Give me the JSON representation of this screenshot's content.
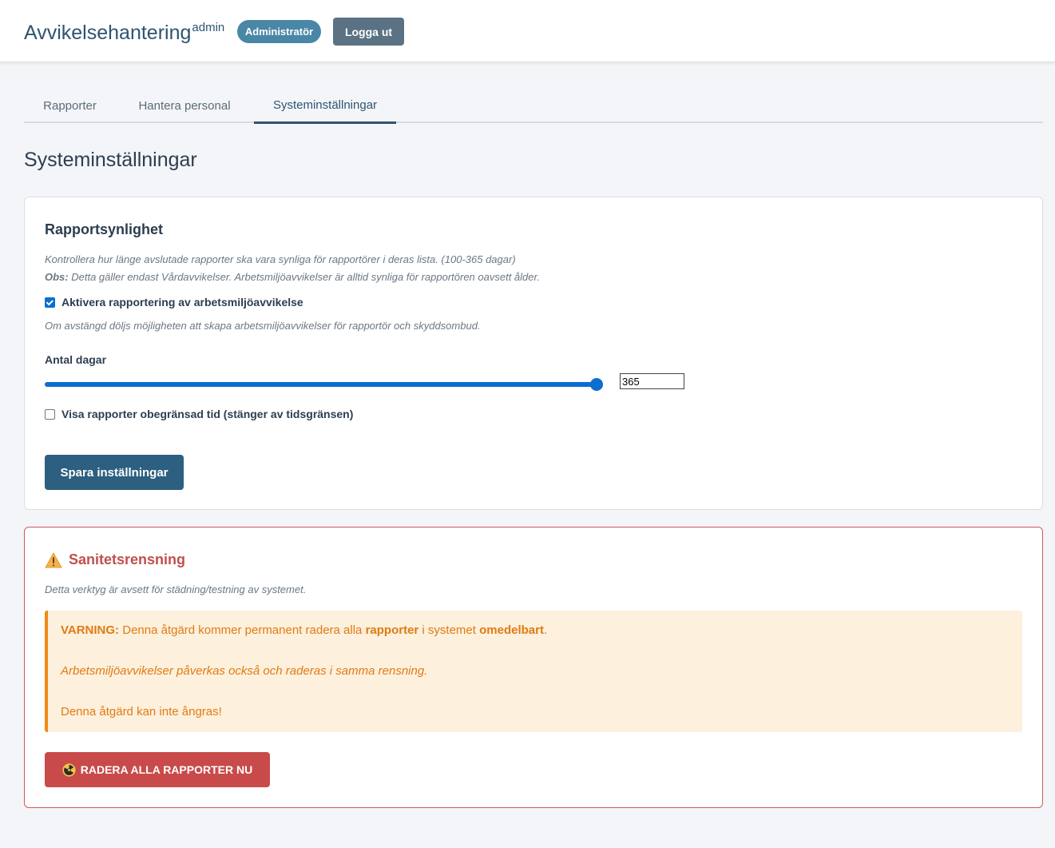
{
  "header": {
    "brand": "Avvikelsehantering",
    "brand_suffix": "admin",
    "role_badge": "Administratör",
    "logout_label": "Logga ut"
  },
  "tabs": [
    {
      "label": "Rapporter",
      "active": false
    },
    {
      "label": "Hantera personal",
      "active": false
    },
    {
      "label": "Systeminställningar",
      "active": true
    }
  ],
  "page_title": "Systeminställningar",
  "report_visibility": {
    "title": "Rapportsynlighet",
    "description": "Kontrollera hur länge avslutade rapporter ska vara synliga för rapportörer i deras lista. (100-365 dagar)",
    "note_prefix": "Obs:",
    "note_text": " Detta gäller endast Vårdavvikelser. Arbetsmiljöavvikelser är alltid synliga för rapportören oavsett ålder.",
    "enable_work_env_label": "Aktivera rapportering av arbetsmiljöavvikelse",
    "enable_work_env_checked": true,
    "enable_work_env_help": "Om avstängd döljs möjligheten att skapa arbetsmiljöavvikelser för rapportör och skyddsombud.",
    "days_label": "Antal dagar",
    "days_min": 100,
    "days_max": 365,
    "days_value": "365",
    "unlimited_label": "Visa rapporter obegränsad tid (stänger av tidsgränsen)",
    "unlimited_checked": false,
    "save_label": "Spara inställningar"
  },
  "sanitize": {
    "title": "Sanitetsrensning",
    "description": "Detta verktyg är avsett för städning/testning av systemet.",
    "warning_label": "VARNING:",
    "warning_text_1": " Denna åtgärd kommer permanent radera alla ",
    "warning_bold_1": "rapporter",
    "warning_text_2": " i systemet ",
    "warning_bold_2": "omedelbart",
    "warning_text_3": ".",
    "warning_line_2": "Arbetsmiljöavvikelser påverkas också och raderas i samma rensning.",
    "warning_line_3": "Denna åtgärd kan inte ångras!",
    "delete_label": "RADERA ALLA RAPPORTER NU"
  },
  "colors": {
    "brand": "#2c5571",
    "accent": "#0b6fd0",
    "danger": "#c94a4a",
    "warning": "#ef8a12"
  }
}
